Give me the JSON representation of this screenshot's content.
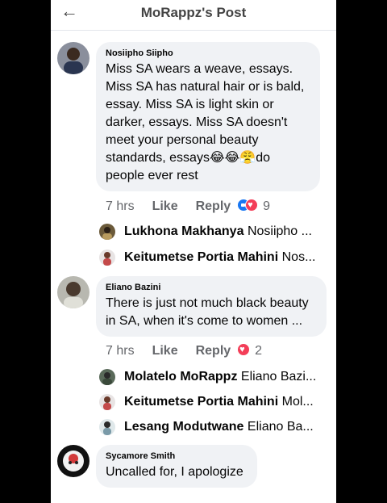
{
  "header": {
    "back_icon": "arrow-left-icon",
    "title": "MoRappz's Post"
  },
  "comments": [
    {
      "author": "Nosiipho Siipho",
      "text": "Miss SA wears a weave, essays. Miss SA has natural hair or is bald, essay. Miss SA is light skin or darker, essays. Miss SA doesn't meet your personal beauty standards, essays😂😂😤do people ever rest",
      "time": "7 hrs",
      "like": "Like",
      "reply": "Reply",
      "reaction_count": "9",
      "replies": [
        {
          "name": "Lukhona Makhanya",
          "text": "Nosiipho ..."
        },
        {
          "name": "Keitumetse Portia Mahini",
          "text": "Nos..."
        }
      ]
    },
    {
      "author": "Eliano Bazini",
      "text": "There is just not much black beauty in SA, when it's come to women ...",
      "time": "7 hrs",
      "like": "Like",
      "reply": "Reply",
      "reaction_count": "2",
      "replies": [
        {
          "name": "Molatelo MoRappz",
          "text": "Eliano Bazi..."
        },
        {
          "name": "Keitumetse Portia Mahini",
          "text": "Mol..."
        },
        {
          "name": "Lesang Modutwane",
          "text": "Eliano Ba..."
        }
      ]
    },
    {
      "author": "Sycamore Smith",
      "text": "Uncalled for, I apologize"
    }
  ],
  "colors": {
    "bubble": "#f0f2f5",
    "meta": "#65676b",
    "like_blue": "#1877f2",
    "love_red": "#f33e58"
  }
}
